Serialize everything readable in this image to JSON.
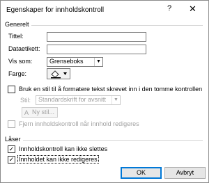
{
  "dialog": {
    "title": "Egenskaper for innholdskontroll",
    "help_label": "?",
    "close_label": "✕"
  },
  "general": {
    "section_label": "Generelt",
    "title_label": "Tittel:",
    "title_value": "",
    "tag_label": "Dataetikett:",
    "tag_value": "",
    "show_as_label": "Vis som:",
    "show_as_value": "Grenseboks",
    "color_label": "Farge:",
    "color_icon": "paint-bucket-icon",
    "use_style_label": "Bruk en stil til å formatere tekst skrevet inn i den tomme kontrollen",
    "use_style_checked": false,
    "style_label": "Stil:",
    "style_value": "Standardskrift for avsnitt",
    "new_style_label": "Ny stil...",
    "remove_label": "Fjern innholdskontroll når innhold redigeres",
    "remove_checked": false
  },
  "locking": {
    "section_label": "Låser",
    "cannot_delete_label": "Innholdskontroll kan ikke slettes",
    "cannot_delete_checked": true,
    "cannot_edit_label": "Innholdet kan ikke redigeres",
    "cannot_edit_checked": true
  },
  "buttons": {
    "ok_label": "OK",
    "cancel_label": "Avbryt"
  },
  "colors": {
    "accent": "#0078d7",
    "disabled_text": "#a0a0a0"
  }
}
